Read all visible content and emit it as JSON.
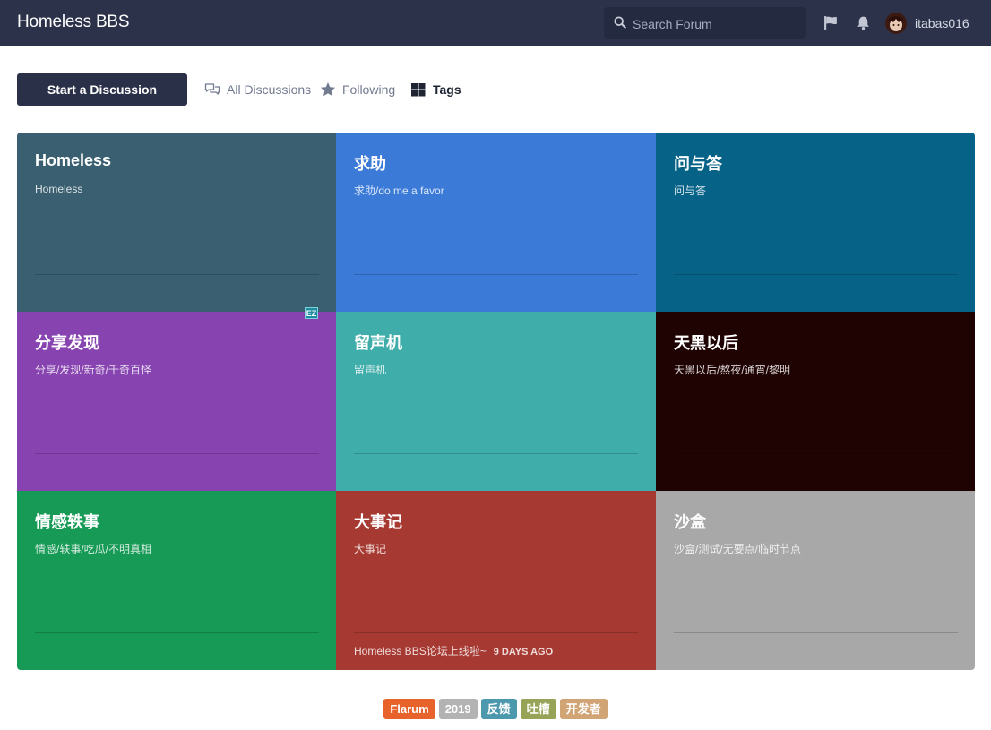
{
  "header": {
    "brand": "Homeless BBS",
    "search_placeholder": "Search Forum",
    "username": "itabas016",
    "icons": [
      "search-icon",
      "flag-icon",
      "bell-icon"
    ]
  },
  "toolbar": {
    "start_label": "Start a Discussion",
    "nav": [
      {
        "label": "All Discussions",
        "icon": "discussions-icon"
      },
      {
        "label": "Following",
        "icon": "star-icon"
      },
      {
        "label": "Tags",
        "icon": "grid-icon",
        "active": true
      }
    ]
  },
  "tags": [
    {
      "name": "Homeless",
      "description": "Homeless",
      "color": "#3a5f70"
    },
    {
      "name": "求助",
      "description": "求助/do me a favor",
      "color": "#3b7ad7"
    },
    {
      "name": "问与答",
      "description": "问与答",
      "color": "#066287"
    },
    {
      "name": "分享发现",
      "description": "分享/发现/新奇/千奇百怪",
      "color": "#8743b0"
    },
    {
      "name": "留声机",
      "description": "留声机",
      "color": "#3fada9"
    },
    {
      "name": "天黑以后",
      "description": "天黑以后/熬夜/通宵/黎明",
      "color": "#1f0202"
    },
    {
      "name": "情感轶事",
      "description": "情感/轶事/吃瓜/不明真相",
      "color": "#179a56"
    },
    {
      "name": "大事记",
      "description": "大事记",
      "color": "#a63a32",
      "last_discussion": "Homeless BBS论坛上线啦~",
      "last_time": "9 DAYS AGO"
    },
    {
      "name": "沙盒",
      "description": "沙盒/测试/无要点/临时节点",
      "color": "#a8a8a8"
    }
  ],
  "ez_badge": "EZ",
  "footer_tags": [
    {
      "label": "Flarum",
      "color": "#e8632b"
    },
    {
      "label": "2019",
      "color": "#b3b3b3"
    },
    {
      "label": "反馈",
      "color": "#4c98ad"
    },
    {
      "label": "吐槽",
      "color": "#97a356"
    },
    {
      "label": "开发者",
      "color": "#d1a476"
    }
  ]
}
